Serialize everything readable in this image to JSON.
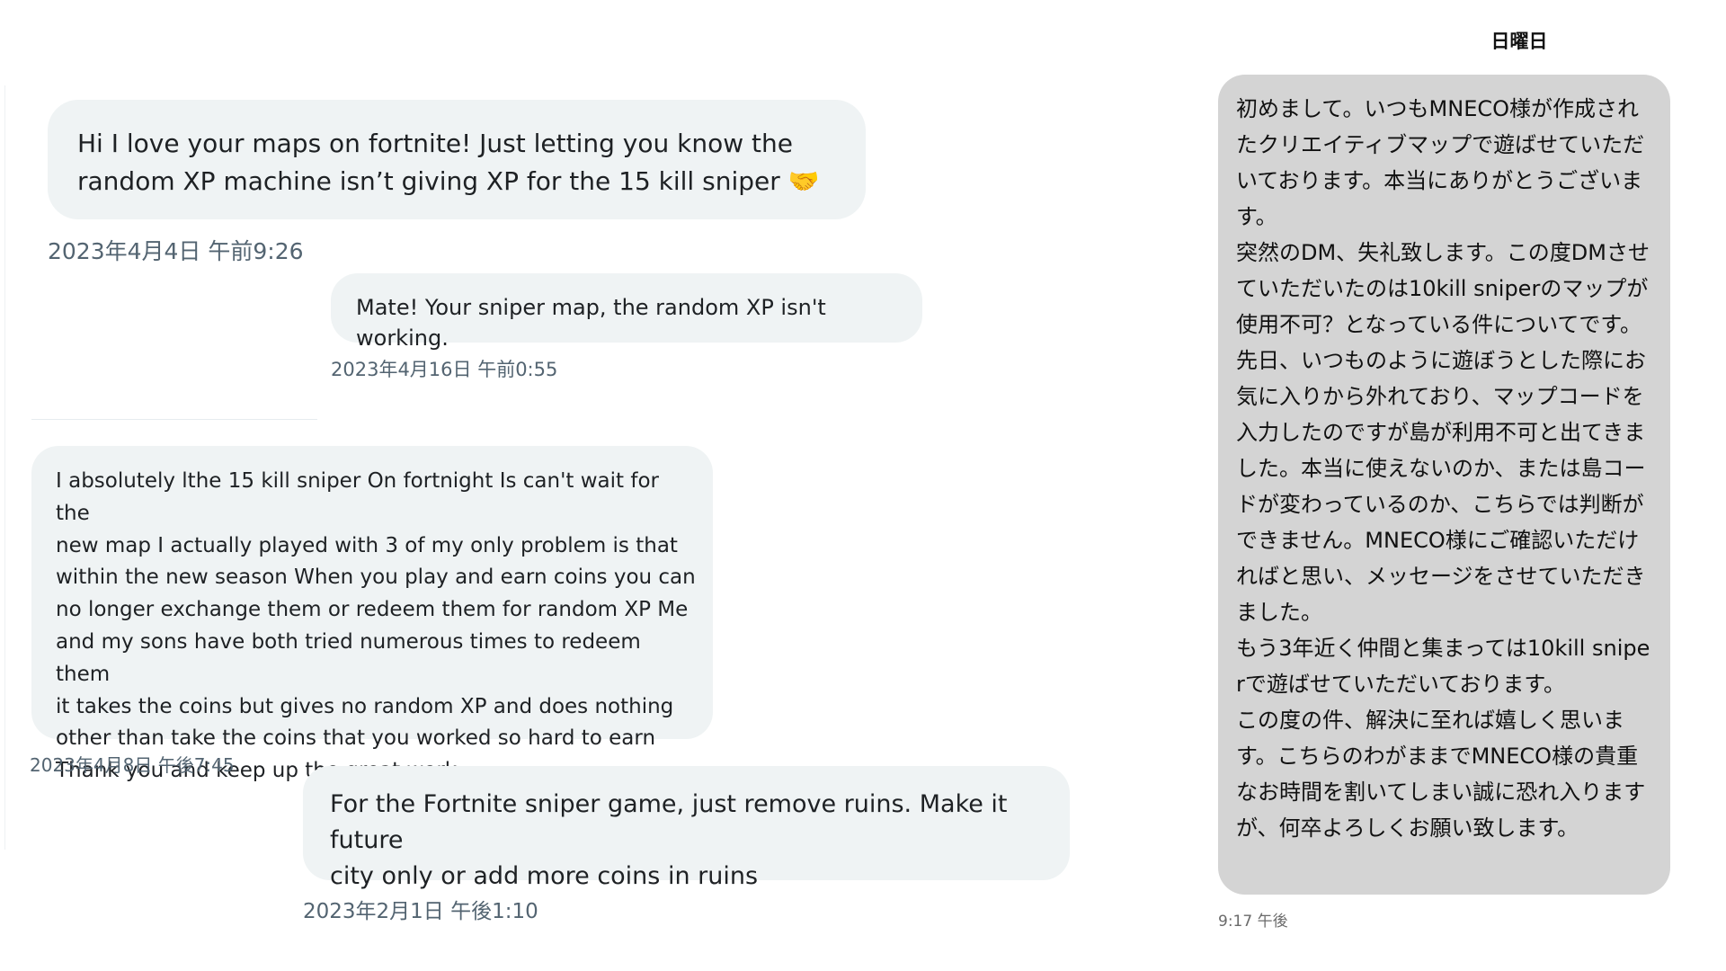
{
  "conversation_left": {
    "messages": [
      {
        "text": "Hi I love your maps on fortnite! Just letting you know the\nrandom XP machine isn’t giving XP for the 15 kill sniper 🤝",
        "timestamp": "2023年4月4日 午前9:26"
      },
      {
        "text": "Mate! Your sniper map, the random XP isn't working.",
        "timestamp": "2023年4月16日 午前0:55"
      },
      {
        "text": "I absolutely lthe 15 kill sniper On fortnight Is can't wait for the\nnew map I actually played with 3 of my only problem is that\nwithin the new season When you play and earn coins you can\nno longer exchange them or redeem them for random XP Me\nand my sons have both tried numerous times to redeem them\nit takes the coins but gives no random XP and does nothing\nother than take the coins that you worked so hard to earn\nThank you and keep up the great work",
        "timestamp": "2023年4月8日 午後7:45"
      },
      {
        "text": "For the Fortnite sniper game, just remove ruins. Make it future\ncity only or add more coins in ruins",
        "timestamp": "2023年2月1日 午後1:10"
      }
    ]
  },
  "conversation_right": {
    "day_label": "日曜日",
    "message": {
      "paragraphs": [
        "初めまして。いつもMNECO様が作成されたクリエイティブマップで遊ばせていただいております。本当にありがとうございます。",
        "突然のDM、失礼致します。この度DMさせていただいたのは10kill sniperのマップが使用不可？となっている件についてです。",
        "先日、いつものように遊ぼうとした際にお気に入りから外れており、マップコードを入力したのですが島が利用不可と出てきました。本当に使えないのか、または島コードが変わっているのか、こちらでは判断ができません。MNECO様にご確認いただければと思い、メッセージをさせていただきました。",
        "もう3年近く仲間と集まっては10kill sniperで遊ばせていただいております。",
        "この度の件、解決に至れば嬉しく思います。こちらのわがままでMNECO様の貴重なお時間を割いてしまい誠に恐れ入りますが、何卒よろしくお願い致します。"
      ],
      "timestamp": "9:17 午後"
    }
  },
  "colors": {
    "left_bubble": "#eff3f4",
    "right_bubble": "#d4d4d4",
    "timestamp_text": "#536471"
  }
}
